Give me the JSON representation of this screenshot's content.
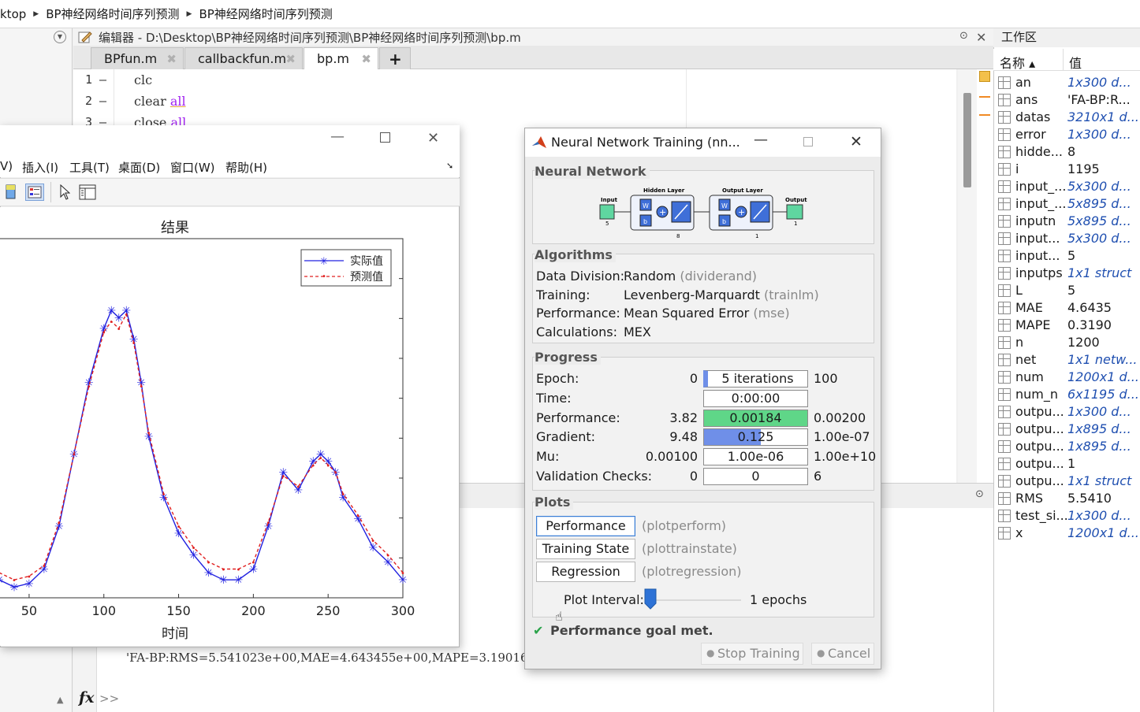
{
  "breadcrumb": {
    "seg0": "ktop",
    "seg1": "BP神经网络时间序列预测",
    "seg2": "BP神经网络时间序列预测"
  },
  "editor": {
    "title": "编辑器 - D:\\Desktop\\BP神经网络时间序列预测\\BP神经网络时间序列预测\\bp.m",
    "tabs": [
      {
        "label": "BPfun.m"
      },
      {
        "label": "callbackfun.m"
      },
      {
        "label": "bp.m"
      }
    ],
    "add_tab": "+",
    "lines": [
      {
        "num": "1 —",
        "plain": "clc",
        "kw": ""
      },
      {
        "num": "2 —",
        "plain": "clear ",
        "kw": "all"
      },
      {
        "num": "3 —",
        "plain": "close ",
        "kw": "all"
      }
    ]
  },
  "command": {
    "output": "'FA-BP:RMS=5.541023e+00,MAE=4.643455e+00,MAPE=3.190167",
    "fx": "fx",
    "prompt": ">>"
  },
  "workspace": {
    "title": "工作区",
    "col_name": "名称 ▴",
    "col_value": "值",
    "rows": [
      {
        "name": "an",
        "value": "1x300 d...",
        "italic": true
      },
      {
        "name": "ans",
        "value": "'FA-BP:R...",
        "italic": false
      },
      {
        "name": "datas",
        "value": "3210x1 d...",
        "italic": true
      },
      {
        "name": "error",
        "value": "1x300 d...",
        "italic": true
      },
      {
        "name": "hidde...",
        "value": "8",
        "italic": false
      },
      {
        "name": "i",
        "value": "1195",
        "italic": false
      },
      {
        "name": "input_...",
        "value": "5x300 d...",
        "italic": true
      },
      {
        "name": "input_...",
        "value": "5x895 d...",
        "italic": true
      },
      {
        "name": "inputn",
        "value": "5x895 d...",
        "italic": true
      },
      {
        "name": "input...",
        "value": "5x300 d...",
        "italic": true
      },
      {
        "name": "input...",
        "value": "5",
        "italic": false
      },
      {
        "name": "inputps",
        "value": "1x1 struct",
        "italic": true
      },
      {
        "name": "L",
        "value": "5",
        "italic": false
      },
      {
        "name": "MAE",
        "value": "4.6435",
        "italic": false
      },
      {
        "name": "MAPE",
        "value": "0.3190",
        "italic": false
      },
      {
        "name": "n",
        "value": "1200",
        "italic": false
      },
      {
        "name": "net",
        "value": "1x1 netw...",
        "italic": true
      },
      {
        "name": "num",
        "value": "1200x1 d...",
        "italic": true
      },
      {
        "name": "num_n",
        "value": "6x1195 d...",
        "italic": true
      },
      {
        "name": "outpu...",
        "value": "1x300 d...",
        "italic": true
      },
      {
        "name": "outpu...",
        "value": "1x895 d...",
        "italic": true
      },
      {
        "name": "outpu...",
        "value": "1x895 d...",
        "italic": true
      },
      {
        "name": "outpu...",
        "value": "1",
        "italic": false
      },
      {
        "name": "outpu...",
        "value": "1x1 struct",
        "italic": true
      },
      {
        "name": "RMS",
        "value": "5.5410",
        "italic": false
      },
      {
        "name": "test_si...",
        "value": "1x300 d...",
        "italic": true
      },
      {
        "name": "x",
        "value": "1200x1 d...",
        "italic": true
      }
    ]
  },
  "figure": {
    "menu": [
      "V)",
      "插入(I)",
      "工具(T)",
      "桌面(D)",
      "窗口(W)",
      "帮助(H)"
    ]
  },
  "chart_data": {
    "type": "line",
    "title": "结果",
    "xlabel": "时间",
    "ylabel": "",
    "xlim": [
      30,
      300
    ],
    "x_ticks": [
      50,
      100,
      150,
      200,
      250,
      300
    ],
    "grid": false,
    "legend_position": "top-right",
    "series": [
      {
        "name": "实际值",
        "style": "blue-star-solid",
        "color": "#2020e0",
        "x": [
          30,
          40,
          50,
          60,
          70,
          80,
          90,
          100,
          105,
          110,
          115,
          120,
          125,
          130,
          140,
          150,
          160,
          170,
          180,
          190,
          200,
          210,
          220,
          230,
          240,
          245,
          250,
          255,
          260,
          270,
          280,
          290,
          300
        ],
        "y": [
          5,
          3,
          4,
          8,
          20,
          40,
          60,
          75,
          80,
          78,
          80,
          72,
          60,
          45,
          28,
          18,
          12,
          7,
          5,
          5,
          8,
          20,
          35,
          30,
          38,
          40,
          38,
          35,
          28,
          22,
          14,
          10,
          5
        ]
      },
      {
        "name": "预测值",
        "style": "red-dot-dashed",
        "color": "#e02020",
        "x": [
          30,
          40,
          50,
          60,
          70,
          80,
          90,
          100,
          105,
          110,
          115,
          120,
          125,
          130,
          140,
          150,
          160,
          170,
          180,
          190,
          200,
          210,
          220,
          230,
          240,
          245,
          250,
          255,
          260,
          270,
          280,
          290,
          300
        ],
        "y": [
          7,
          5,
          6,
          9,
          21,
          40,
          59,
          74,
          77,
          75,
          79,
          71,
          59,
          46,
          29,
          20,
          14,
          10,
          8,
          8,
          10,
          21,
          34,
          31,
          37,
          39,
          37,
          35,
          29,
          23,
          16,
          12,
          7
        ]
      }
    ]
  },
  "nn": {
    "title": "Neural Network Training (nn...",
    "section_network": "Neural Network",
    "diagram": {
      "input": "Input",
      "hidden": "Hidden Layer",
      "output_layer": "Output Layer",
      "output": "Output",
      "n_in": "5",
      "n_hidden": "8",
      "n_out_layer": "1",
      "n_out": "1",
      "w": "W",
      "b": "b"
    },
    "section_algorithms": "Algorithms",
    "algorithms": [
      {
        "key": "Data Division:",
        "value": "Random",
        "hint": "(dividerand)"
      },
      {
        "key": "Training:",
        "value": "Levenberg-Marquardt",
        "hint": "(trainlm)"
      },
      {
        "key": "Performance:",
        "value": "Mean Squared Error",
        "hint": "(mse)"
      },
      {
        "key": "Calculations:",
        "value": "MEX",
        "hint": ""
      }
    ],
    "section_progress": "Progress",
    "progress": [
      {
        "key": "Epoch:",
        "start": "0",
        "current": "5 iterations",
        "end": "100",
        "fill": 0.05,
        "color": "#6f8fe8"
      },
      {
        "key": "Time:",
        "start": "",
        "current": "0:00:00",
        "end": "",
        "fill": 0,
        "color": "#ffffff"
      },
      {
        "key": "Performance:",
        "start": "3.82",
        "current": "0.00184",
        "end": "0.00200",
        "fill": 1.0,
        "color": "#5fd688"
      },
      {
        "key": "Gradient:",
        "start": "9.48",
        "current": "0.125",
        "end": "1.00e-07",
        "fill": 0.55,
        "color": "#6f8fe8"
      },
      {
        "key": "Mu:",
        "start": "0.00100",
        "current": "1.00e-06",
        "end": "1.00e+10",
        "fill": 0,
        "color": "#ffffff"
      },
      {
        "key": "Validation Checks:",
        "start": "0",
        "current": "0",
        "end": "6",
        "fill": 0,
        "color": "#ffffff"
      }
    ],
    "section_plots": "Plots",
    "plots": [
      {
        "label": "Performance",
        "hint": "(plotperform)"
      },
      {
        "label": "Training State",
        "hint": "(plottrainstate)"
      },
      {
        "label": "Regression",
        "hint": "(plotregression)"
      }
    ],
    "plot_interval_label": "Plot Interval:",
    "plot_interval_value": "1 epochs",
    "status": "Performance goal met.",
    "stop_label": "Stop Training",
    "cancel_label": "Cancel"
  }
}
